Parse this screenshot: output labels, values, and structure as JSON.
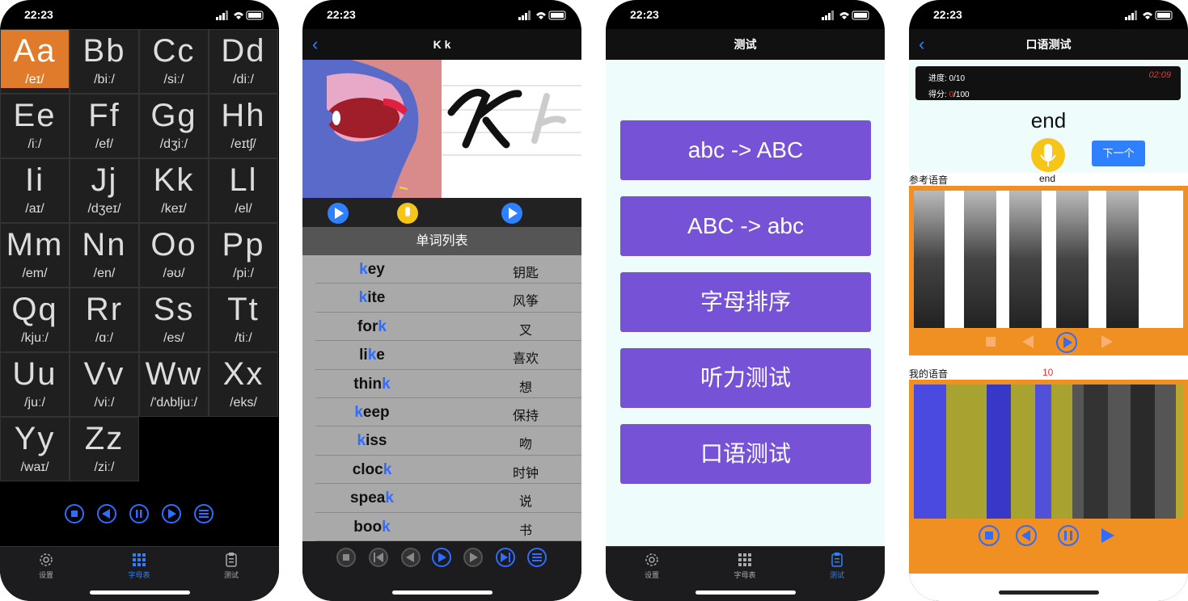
{
  "status_time": "22:23",
  "phone1": {
    "letters": [
      {
        "l": "Aa",
        "p": "/eɪ/"
      },
      {
        "l": "Bb",
        "p": "/biː/"
      },
      {
        "l": "Cc",
        "p": "/siː/"
      },
      {
        "l": "Dd",
        "p": "/diː/"
      },
      {
        "l": "Ee",
        "p": "/iː/"
      },
      {
        "l": "Ff",
        "p": "/ef/"
      },
      {
        "l": "Gg",
        "p": "/dʒiː/"
      },
      {
        "l": "Hh",
        "p": "/eɪtʃ/"
      },
      {
        "l": "Ii",
        "p": "/aɪ/"
      },
      {
        "l": "Jj",
        "p": "/dʒeɪ/"
      },
      {
        "l": "Kk",
        "p": "/keɪ/"
      },
      {
        "l": "Ll",
        "p": "/el/"
      },
      {
        "l": "Mm",
        "p": "/em/"
      },
      {
        "l": "Nn",
        "p": "/en/"
      },
      {
        "l": "Oo",
        "p": "/əʊ/"
      },
      {
        "l": "Pp",
        "p": "/piː/"
      },
      {
        "l": "Qq",
        "p": "/kjuː/"
      },
      {
        "l": "Rr",
        "p": "/ɑː/"
      },
      {
        "l": "Ss",
        "p": "/es/"
      },
      {
        "l": "Tt",
        "p": "/tiː/"
      },
      {
        "l": "Uu",
        "p": "/juː/"
      },
      {
        "l": "Vv",
        "p": "/viː/"
      },
      {
        "l": "Ww",
        "p": "/'dʌbljuː/"
      },
      {
        "l": "Xx",
        "p": "/eks/"
      },
      {
        "l": "Yy",
        "p": "/waɪ/"
      },
      {
        "l": "Zz",
        "p": "/ziː/"
      }
    ],
    "tabs": [
      "设置",
      "字母表",
      "测试"
    ]
  },
  "phone2": {
    "title": "K k",
    "word_list_header": "单词列表",
    "words": [
      {
        "pre": "",
        "hl": "k",
        "post": "ey",
        "zh": "钥匙"
      },
      {
        "pre": "",
        "hl": "k",
        "post": "ite",
        "zh": "风筝"
      },
      {
        "pre": "for",
        "hl": "k",
        "post": "",
        "zh": "叉"
      },
      {
        "pre": "li",
        "hl": "k",
        "post": "e",
        "zh": "喜欢"
      },
      {
        "pre": "thin",
        "hl": "k",
        "post": "",
        "zh": "想"
      },
      {
        "pre": "",
        "hl": "k",
        "post": "eep",
        "zh": "保持"
      },
      {
        "pre": "",
        "hl": "k",
        "post": "iss",
        "zh": "吻"
      },
      {
        "pre": "cloc",
        "hl": "k",
        "post": "",
        "zh": "时钟"
      },
      {
        "pre": "spea",
        "hl": "k",
        "post": "",
        "zh": "说"
      },
      {
        "pre": "boo",
        "hl": "k",
        "post": "",
        "zh": "书"
      }
    ]
  },
  "phone3": {
    "title": "测试",
    "buttons": [
      "abc -> ABC",
      "ABC -> abc",
      "字母排序",
      "听力测试",
      "口语测试"
    ],
    "tabs": [
      "设置",
      "字母表",
      "测试"
    ]
  },
  "phone4": {
    "title": "口语测试",
    "progress": "进度: 0/10",
    "score_label": "得分: ",
    "score_value": "0",
    "score_total": "/100",
    "timer": "02:09",
    "word": "end",
    "next_button": "下一个",
    "ref_label": "参考语音",
    "ref_word": "end",
    "my_label": "我的语音",
    "my_score": "10"
  },
  "colors": {
    "accent": "#2f80ff",
    "orange": "#e07b2c",
    "purple": "#7652d6",
    "spec_frame": "#f08f22"
  }
}
